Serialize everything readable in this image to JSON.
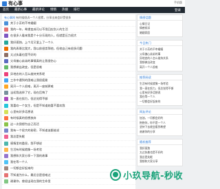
{
  "header": {
    "logo_text": "有心事",
    "login_text": "手机版"
  },
  "nav": {
    "items": [
      "首页",
      "最新心事",
      "最新评论",
      "悄悄",
      "热搜",
      "排行"
    ],
    "right": "登录"
  },
  "left": {
    "title_prefix": "有心事网",
    "title_rest": "有时候倾诉一个人很累，分享出来会好受很多",
    "items": [
      {
        "text": "关于小芳的不幸婚姻",
        "color": "#4a90d9"
      },
      {
        "text": "我的一年，希望变成可以不用回应别人的生活",
        "color": "#e57373"
      },
      {
        "text": "在很多人看来我是个十分乐观的人，但就是压力很大",
        "color": "#7e57c2"
      },
      {
        "text": "我好孤独，上个月又爱上了一个人",
        "color": "#26a69a"
      },
      {
        "text": "我的表哥比我大，我以前很崇拜他，但他自己有很多问题",
        "color": "#ef6c00"
      },
      {
        "text": "太过执着也是不好的",
        "color": "#8d6e63"
      },
      {
        "text": "父母偏心弟弟的事情真的让我很伤心",
        "color": "#5c6bc0"
      },
      {
        "text": "我想做出改变，但是很难",
        "color": "#66bb6a"
      },
      {
        "text": "异地恋的人怎么维持关系呢",
        "color": "#ec407a"
      },
      {
        "text": "工作中遇到的困难让我很疲惫",
        "color": "#42a5f5"
      },
      {
        "text": "离开一个人很难，离开一座城更难",
        "color": "#ffa726"
      },
      {
        "text": "当初我选择了它，现在后悔了",
        "color": "#78909c"
      },
      {
        "text": "我一直在努力，但总觉得不够",
        "color": "#ab47bc"
      },
      {
        "text": "我喜欢一个女生，但是不知道她喜不喜欢我",
        "color": "#26c6da"
      },
      {
        "text": "心里有好多话想说",
        "color": "#d4e157"
      },
      {
        "text": "有时候真的很想放弃",
        "color": "#ff7043"
      },
      {
        "text": "这一次我想为自己而活",
        "color": "#8bc34a"
      },
      {
        "text": "我有一个很大的秘密，不知道该跟谁说",
        "color": "#7986cb"
      },
      {
        "text": "我总是失眠",
        "color": "#f06292"
      },
      {
        "text": "感情里的委屈，我不想说",
        "color": "#4db6ac"
      },
      {
        "text": "生活有时候就像一场考验",
        "color": "#ffb74d"
      },
      {
        "text": "我想和大家分享一下我的故事",
        "color": "#9575cd"
      },
      {
        "text": "我在等一个人",
        "color": "#4fc3f7"
      },
      {
        "text": "一切都会好起来的",
        "color": "#a1887f"
      },
      {
        "text": "不知道为什么，最近总是很难过",
        "color": "#e57373"
      },
      {
        "text": "谢谢你，曾经出现在我的生命里",
        "color": "#81c784"
      }
    ]
  },
  "right": {
    "boxes": [
      {
        "title": "情感话题",
        "lines": [
          "心情日记",
          "情感倾诉",
          "婚姻家庭"
        ]
      },
      {
        "title": "今日热门",
        "lines": [
          "关于小芳的不幸婚姻",
          "父母偏心弟弟的事",
          "异地恋的人怎么维持关系",
          "我想做出改变",
          "离开一个人很难"
        ]
      },
      {
        "title": "推荐阅读",
        "lines": [
          "生活有时候就像一场考验",
          "我一直在努力，但总觉得不够",
          "心里有好多话想说",
          "我在等一个人",
          "一切都会好起来的"
        ]
      },
      {
        "title": "网友评论",
        "lines": [
          "加油，一切都会好的",
          "抱抱你，你不是一个人",
          "坚持下去就会看到希望",
          "谢谢你的分享"
        ]
      },
      {
        "title": "随机推荐",
        "lines": [
          "我好孤独",
          "太过执着也是不好的",
          "我总是失眠",
          "我想和大家分享"
        ]
      }
    ]
  },
  "watermark": {
    "text": "小玖导航-秒收"
  }
}
